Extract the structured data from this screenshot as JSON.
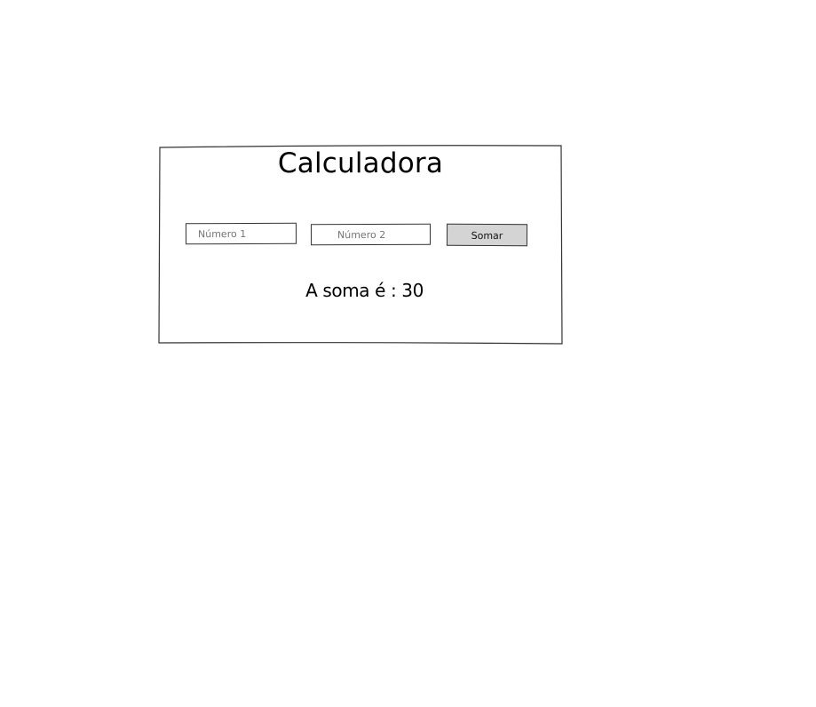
{
  "calculator": {
    "title": "Calculadora",
    "number1_placeholder": "Número 1",
    "number2_placeholder": "Número 2",
    "sum_button_label": "Somar",
    "result_text": "A soma é : 30"
  },
  "colors": {
    "background": "#ffffff",
    "border": "#333333",
    "button_fill": "#d4d4d4",
    "text": "#000000"
  }
}
